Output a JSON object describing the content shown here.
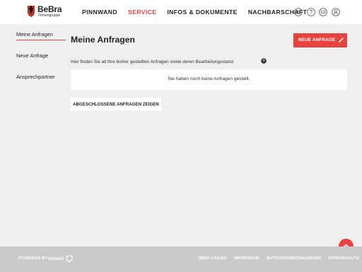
{
  "header": {
    "logo_text": "BeBra",
    "logo_sub": "Firmengruppe",
    "nav": [
      {
        "label": "PINNWAND",
        "active": false
      },
      {
        "label": "SERVICE",
        "active": true
      },
      {
        "label": "INFOS & DOKUMENTE",
        "active": false
      },
      {
        "label": "NACHBARSCHAFT",
        "active": false
      }
    ],
    "icons": [
      "mail-icon",
      "help-circle-icon",
      "chat-icon",
      "user-icon"
    ]
  },
  "sidebar": {
    "items": [
      {
        "label": "Meine Anfragen",
        "active": true
      },
      {
        "label": "Neue Anfrage",
        "active": false
      },
      {
        "label": "Ansprechpartner",
        "active": false
      }
    ]
  },
  "main": {
    "title": "Meine Anfragen",
    "new_button_label": "NEUE ANFRAGE",
    "intro": "Hier finden Sie all Ihre bisher gestellten Anfragen sowie deren Bearbeitungsstand.",
    "empty_message": "Sie haben noch keine Anfragen gestellt.",
    "closed_button_label": "ABGESCHLOSSENE ANFRAGEN ZEIGEN"
  },
  "footer": {
    "powered_by": "POWERED BY",
    "casavi": "casavi",
    "links": [
      "ÜBER CASAVI",
      "IMPRESSUM",
      "NUTZUNGSBEDINGUNGEN",
      "DATENSCHUTZ"
    ]
  },
  "colors": {
    "accent": "#e8423f",
    "background": "#efefef",
    "footer": "#c9c9c9"
  }
}
